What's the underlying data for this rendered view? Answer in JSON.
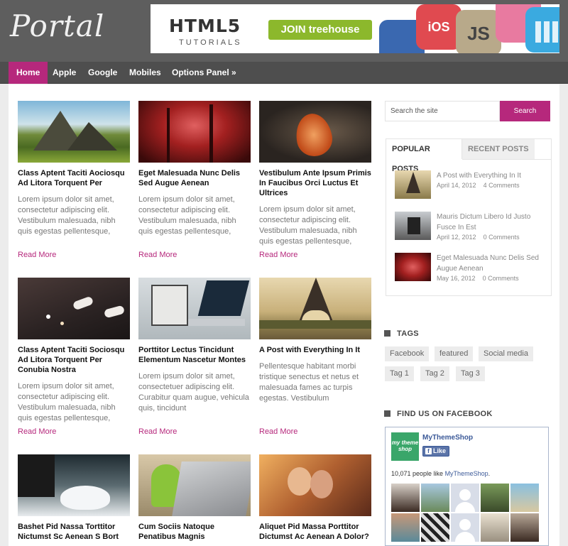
{
  "site": {
    "logo": "Portal"
  },
  "banner": {
    "title": "HTML5",
    "subtitle": "TUTORIALS",
    "button": "JOIN treehouse",
    "badges": [
      "iOS",
      "JS"
    ]
  },
  "nav": {
    "items": [
      {
        "label": "Home",
        "active": true
      },
      {
        "label": "Apple"
      },
      {
        "label": "Google"
      },
      {
        "label": "Mobiles"
      },
      {
        "label": "Options Panel »"
      }
    ]
  },
  "posts": [
    {
      "title": "Class Aptent Taciti Aociosqu Ad Litora Torquent Per",
      "excerpt": "Lorem ipsum dolor sit amet, consectetur adipiscing elit. Vestibulum malesuada, nibh quis egestas pellentesque,",
      "read_more": "Read More",
      "thumb": "mountain-landscape"
    },
    {
      "title": "Eget Malesuada Nunc Delis Sed Augue Aenean",
      "excerpt": "Lorem ipsum dolor sit amet, consectetur adipiscing elit. Vestibulum malesuada, nibh quis egestas pellentesque,",
      "read_more": "Read More",
      "thumb": "red-forest"
    },
    {
      "title": "Vestibulum Ante Ipsum Primis In Faucibus Orci Luctus Et Ultrices",
      "excerpt": "Lorem ipsum dolor sit amet, consectetur adipiscing elit. Vestibulum malesuada, nibh quis egestas pellentesque,",
      "read_more": "Read More",
      "thumb": "autumn-leaf"
    },
    {
      "title": "Class Aptent Taciti Sociosqu Ad Litora Torquent Per Conubia Nostra",
      "excerpt": "Lorem ipsum dolor sit amet, consectetur adipiscing elit. Vestibulum malesuada, nibh quis egestas pellentesque,",
      "read_more": "Read More",
      "thumb": "feet-flowers"
    },
    {
      "title": "Porttitor Lectus Tincidunt Elementum Nascetur Montes",
      "excerpt": "Lorem ipsum dolor sit amet, consectetuer adipiscing elit. Curabitur quam augue, vehicula quis, tincidunt",
      "read_more": "Read More",
      "thumb": "laptop-desk"
    },
    {
      "title": "A Post with Everything In It",
      "excerpt": "Pellentesque habitant morbi tristique senectus et netus et malesuada fames ac turpis egestas. Vestibulum",
      "read_more": "Read More",
      "thumb": "eiffel-tower"
    },
    {
      "title": "Bashet Pid Nassa Torttitor Nictumst Sc Aenean S Bort",
      "excerpt": "",
      "read_more": "",
      "thumb": "imac-mouse"
    },
    {
      "title": "Cum Sociis Natoque Penatibus Magnis",
      "excerpt": "",
      "read_more": "",
      "thumb": "android-macbook"
    },
    {
      "title": "Aliquet Pid Massa Porttitor Dictumst Ac Aenean A Dolor?",
      "excerpt": "",
      "read_more": "",
      "thumb": "couple-kiss"
    }
  ],
  "search": {
    "placeholder": "Search the site",
    "button": "Search"
  },
  "tabs": {
    "active": "POPULAR POSTS",
    "inactive": "RECENT POSTS"
  },
  "popular": [
    {
      "title": "A Post with Everything In It",
      "date": "April 14, 2012",
      "comments": "4 Comments"
    },
    {
      "title": "Mauris Dictum Libero Id Justo Fusce In Est",
      "date": "April 12, 2012",
      "comments": "0 Comments"
    },
    {
      "title": "Eget Malesuada Nunc Delis Sed Augue Aenean",
      "date": "May 16, 2012",
      "comments": "0 Comments"
    }
  ],
  "tags": {
    "heading": "TAGS",
    "items": [
      "Facebook",
      "featured",
      "Social media",
      "Tag 1",
      "Tag 2",
      "Tag 3"
    ]
  },
  "facebook": {
    "heading": "FIND US ON FACEBOOK",
    "logo_text": "my theme shop",
    "page_name": "MyThemeShop",
    "like": "Like",
    "count_prefix": "10,071 people like ",
    "count_link": "MyThemeShop",
    "count_suffix": "."
  },
  "colors": {
    "accent": "#b6287c",
    "header": "#5e5e5e",
    "nav": "#4e4e4e"
  }
}
